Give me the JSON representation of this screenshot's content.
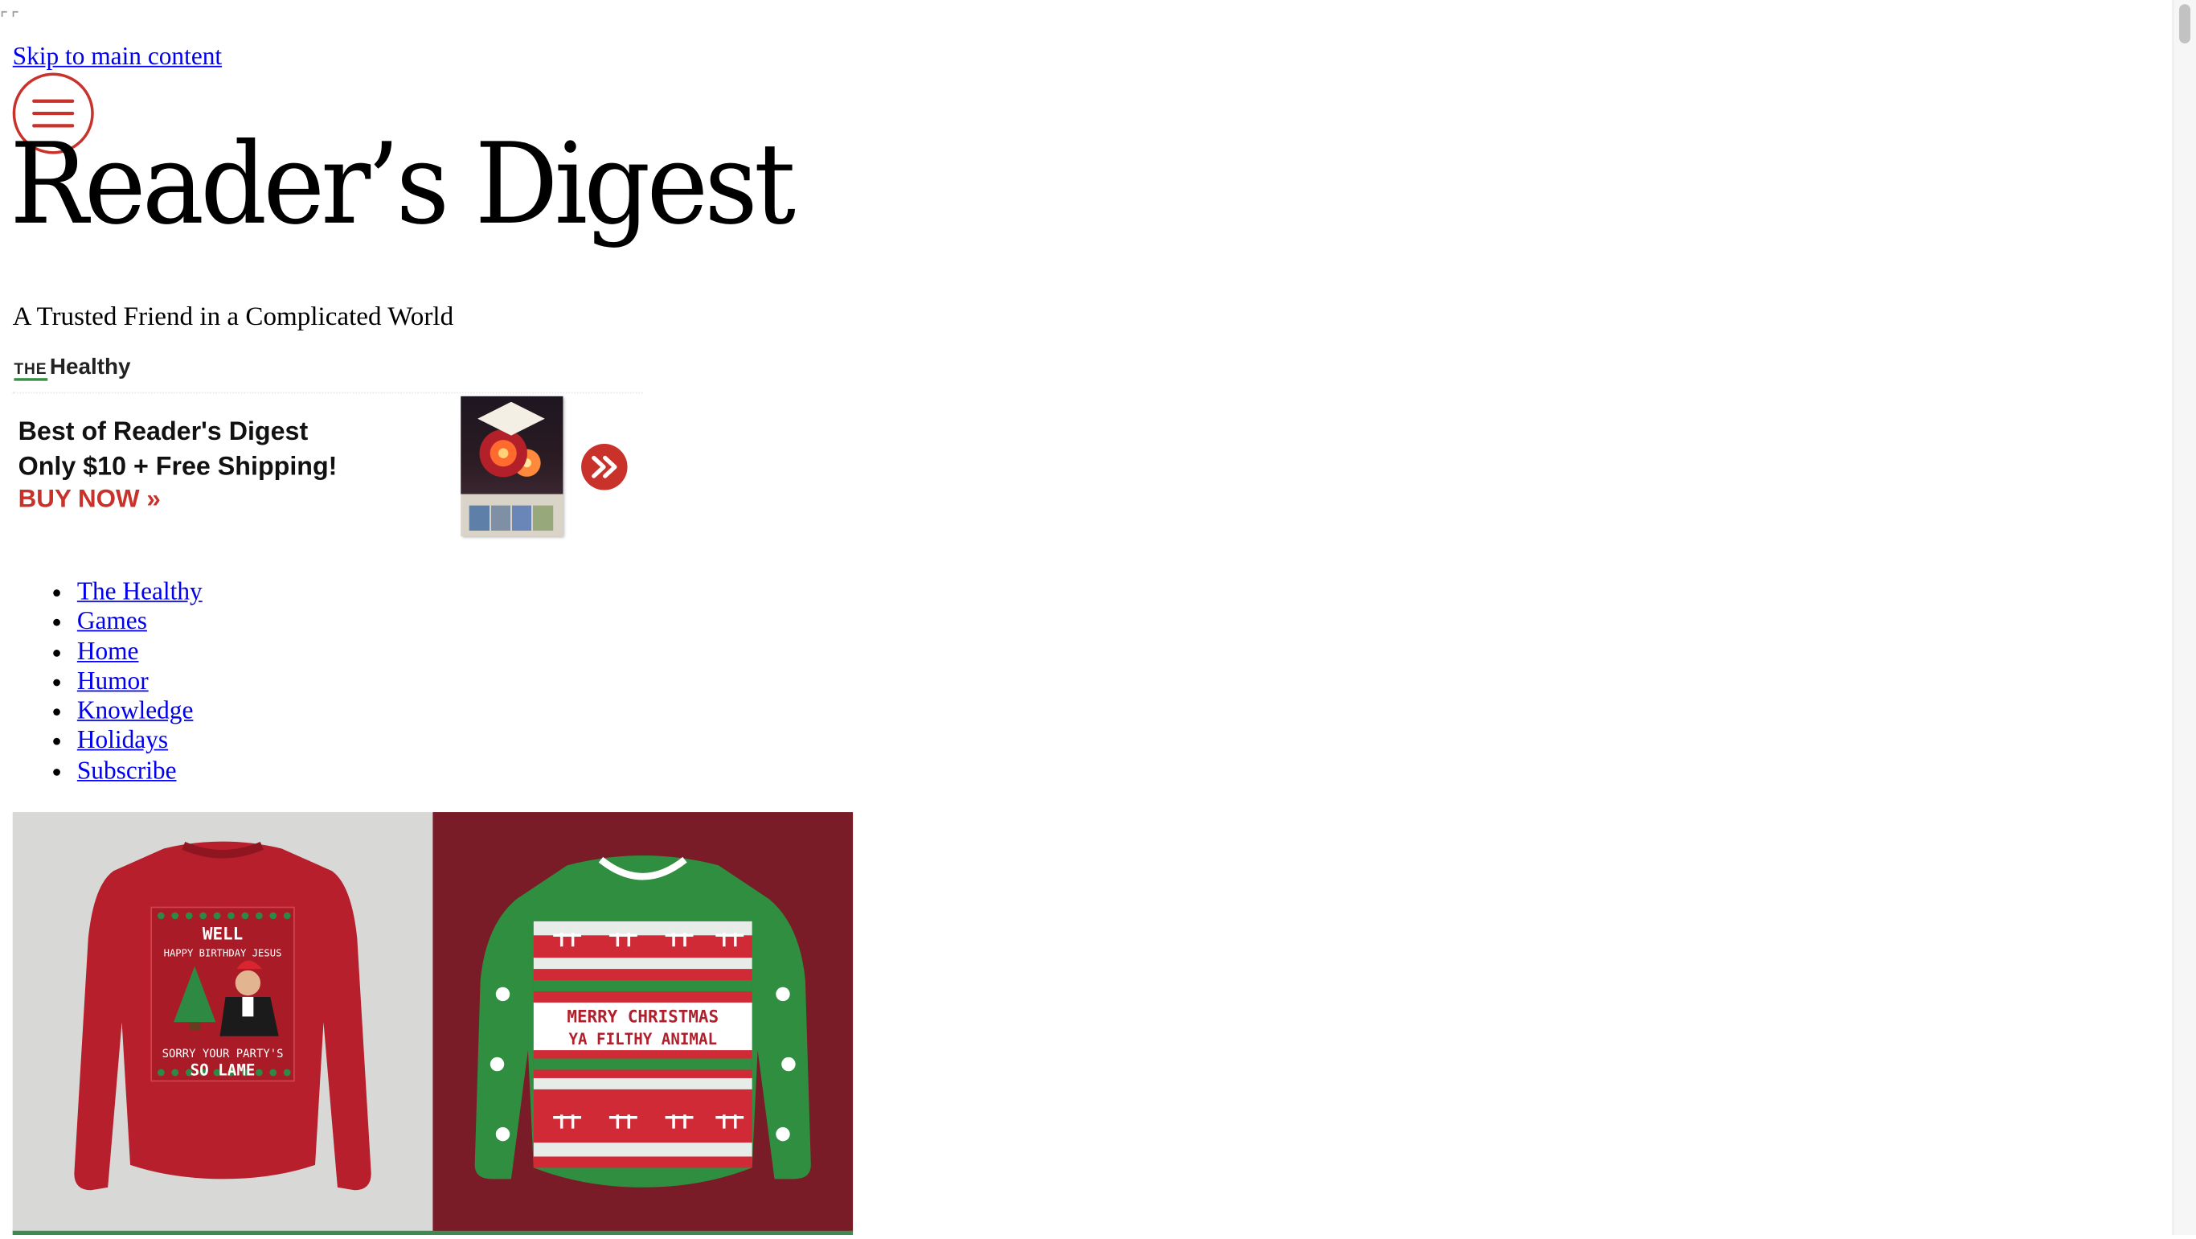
{
  "skip_link": "Skip to main content",
  "logo": "Reader’s Digest",
  "tagline": "A Trusted Friend in a Complicated World",
  "sub_brand": {
    "the": "THE",
    "name": "Healthy"
  },
  "ad": {
    "line1": "Best of Reader's Digest",
    "line2": "Only $10 + Free Shipping!",
    "cta": "BUY NOW »"
  },
  "nav": [
    {
      "label": "The Healthy"
    },
    {
      "label": "Games"
    },
    {
      "label": "Home"
    },
    {
      "label": "Humor"
    },
    {
      "label": "Knowledge"
    },
    {
      "label": "Holidays"
    },
    {
      "label": "Subscribe"
    }
  ],
  "hero": {
    "left_sweater": {
      "line1": "WELL",
      "line2": "HAPPY BIRTHDAY JESUS",
      "line3": "SORRY YOUR PARTY'S",
      "line4": "SO LAME"
    },
    "right_sweater": {
      "line1": "MERRY CHRISTMAS",
      "line2": "YA FILTHY ANIMAL"
    }
  },
  "colors": {
    "brand_red": "#c8322b",
    "link": "#0000ee",
    "green": "#3e8a50",
    "burgundy": "#7a1b28"
  }
}
